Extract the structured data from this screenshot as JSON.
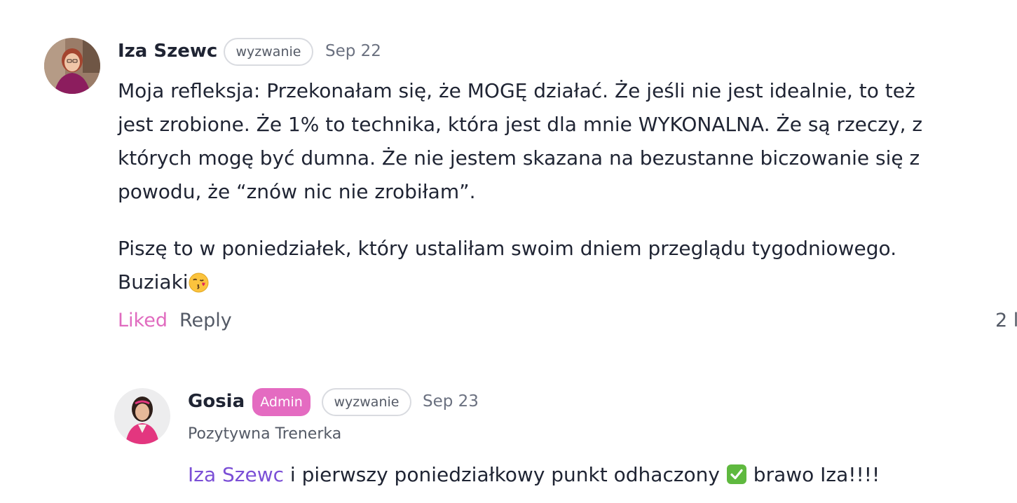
{
  "comments": [
    {
      "author": "Iza Szewc",
      "tag": "wyzwanie",
      "date": "Sep 22",
      "paragraph1": [
        "Moja refleksja: Przekonałam się, że MOGĘ  działać. Że jeśli nie jest idealnie, to też",
        "jest zrobione. Że 1% to technika, która jest dla mnie WYKONALNA. Że są rzeczy, z",
        "których mogę być dumna. Że nie jestem skazana na bezustanne biczowanie się z",
        "powodu, że “znów nic nie zrobiłam”."
      ],
      "paragraph2_line1": "Piszę to w poniedziałek, który ustaliłam swoim dniem przeglądu tygodniowego.",
      "paragraph2_line2": "Buziaki",
      "emoji": "kissing-face-icon",
      "liked_label": "Liked",
      "reply_label": "Reply",
      "likes_count": "2 l"
    },
    {
      "author": "Gosia",
      "role_badge": "Admin",
      "tag": "wyzwanie",
      "date": "Sep 23",
      "subtitle": "Pozytywna Trenerka",
      "mention": "Iza Szewc",
      "text_before_emoji": " i pierwszy poniedziałkowy punkt odhaczony ",
      "emoji": "check-mark-button-icon",
      "text_after_emoji": " brawo Iza!!!!"
    }
  ],
  "colors": {
    "liked": "#e06bbf",
    "admin_badge": "#e46bc1",
    "mention": "#7b4fd6",
    "text": "#1f2433",
    "muted": "#6b7180",
    "pill_border": "#d9dbe0"
  }
}
